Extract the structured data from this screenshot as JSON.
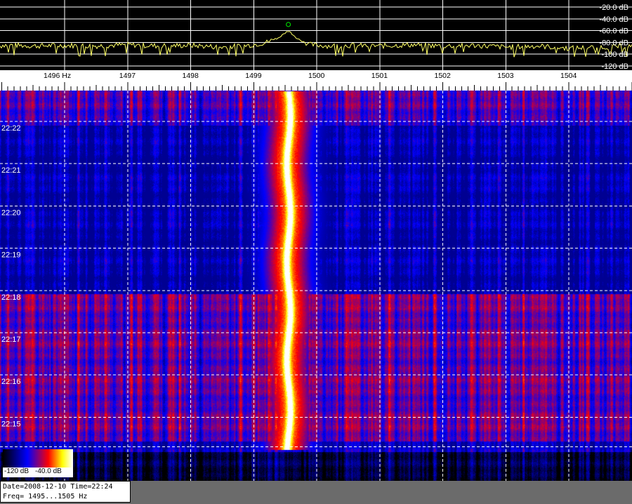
{
  "chart_data": [
    {
      "type": "line",
      "title": "",
      "y_unit": "dB",
      "ylim": [
        -125,
        -15
      ],
      "y_ticks": [
        "-20.0 dB",
        "-40.0 dB",
        "-60.0 dB",
        "-80.0 dB",
        "-100 dB",
        "-120 dB"
      ],
      "y_tick_values": [
        -20,
        -40,
        -60,
        -80,
        -100,
        -120
      ],
      "xlim": [
        1495,
        1505
      ],
      "peak": {
        "x": 1499.55,
        "y": -52
      },
      "series": [
        {
          "x": [
            1495.0,
            1495.5,
            1496.0,
            1496.5,
            1497.0,
            1497.5,
            1498.0,
            1498.5,
            1498.8,
            1499.0,
            1499.2,
            1499.4,
            1499.55,
            1499.7,
            1499.9,
            1500.2,
            1500.5,
            1501.0,
            1501.5,
            1502.0,
            1502.5,
            1503.0,
            1503.5,
            1504.0,
            1504.5,
            1505.0
          ],
          "y": [
            -84,
            -86,
            -85,
            -86,
            -84,
            -86,
            -85,
            -88,
            -86,
            -84,
            -80,
            -72,
            -60,
            -74,
            -84,
            -86,
            -85,
            -86,
            -84,
            -86,
            -85,
            -88,
            -86,
            -90,
            -88,
            -86
          ]
        }
      ]
    },
    {
      "type": "heatmap",
      "title": "",
      "x_unit": "Hz",
      "x_ticks": [
        "1496 Hz",
        "1497",
        "1498",
        "1499",
        "1500",
        "1501",
        "1502",
        "1503",
        "1504"
      ],
      "x_tick_values": [
        1496,
        1497,
        1498,
        1499,
        1500,
        1501,
        1502,
        1503,
        1504
      ],
      "xlim": [
        1495,
        1505
      ],
      "y_ticks": [
        "22:22",
        "22:21",
        "22:20",
        "22:19",
        "22:18",
        "22:17",
        "22:16",
        "22:15"
      ],
      "y_tick_minutes": [
        22,
        21,
        20,
        19,
        18,
        17,
        16,
        15
      ],
      "time_range": [
        "22:14",
        "22:24"
      ],
      "signal_center_hz": 1499.55,
      "colorscale": {
        "min_label": "-120 dB",
        "max_label": "-40.0 dB",
        "min": -120,
        "max": -40,
        "colors": [
          "#000000",
          "#0000ff",
          "#ff0000",
          "#ffff00",
          "#ffffff"
        ]
      }
    }
  ],
  "status": {
    "line1": "Date=2008-12-10 Time=22:24",
    "line2": "Freq= 1495...1505 Hz"
  },
  "colors": {
    "trace": "#ffff66",
    "peak_marker": "#00cc00",
    "grid": "#ffffff",
    "status_bg": "#6b6b6b"
  }
}
